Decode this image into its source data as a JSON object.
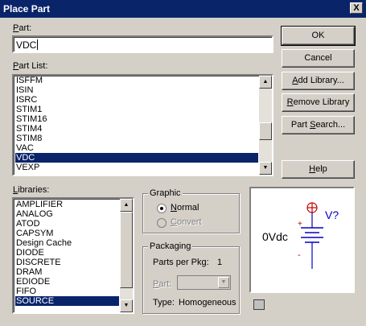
{
  "window": {
    "title": "Place Part",
    "close_glyph": "X"
  },
  "part": {
    "label_key": "P",
    "label_rest": "art:",
    "value": "VDC"
  },
  "part_list": {
    "label_key": "P",
    "label_mid": "art List",
    "label_rest": ":",
    "items": [
      "ISFFM",
      "ISIN",
      "ISRC",
      "STIM1",
      "STIM16",
      "STIM4",
      "STIM8",
      "VAC",
      "VDC",
      "VEXP"
    ],
    "selected": "VDC"
  },
  "libraries": {
    "label_key": "L",
    "label_rest": "ibraries:",
    "items": [
      "AMPLIFIER",
      "ANALOG",
      "ATOD",
      "CAPSYM",
      "Design Cache",
      "DIODE",
      "DISCRETE",
      "DRAM",
      "EDIODE",
      "FIFO",
      "SOURCE"
    ],
    "selected": "SOURCE"
  },
  "buttons": {
    "ok": "OK",
    "cancel": "Cancel",
    "add_library_key": "A",
    "add_library_rest": "dd Library...",
    "remove_library_key": "R",
    "remove_library_rest": "emove Library",
    "part_search_pre": "Part ",
    "part_search_key": "S",
    "part_search_rest": "earch...",
    "help_key": "H",
    "help_rest": "elp"
  },
  "graphic": {
    "title": "Graphic",
    "normal_key": "N",
    "normal_rest": "ormal",
    "normal_checked": true,
    "convert_key": "C",
    "convert_rest": "onvert",
    "convert_enabled": false
  },
  "packaging": {
    "title": "Packaging",
    "parts_per_pkg_label": "Parts per Pkg:",
    "parts_per_pkg_value": "1",
    "part_label_key": "P",
    "part_label_rest": "art:",
    "type_label": "Type:",
    "type_value": "Homogeneous"
  },
  "preview": {
    "value_text": "0Vdc",
    "ref_text": "V?",
    "plus": "+",
    "minus": "-"
  },
  "colors": {
    "titlebar": "#0a246a",
    "selection": "#0a246a",
    "symbol_red": "#c00000",
    "symbol_blue": "#0000c0"
  }
}
